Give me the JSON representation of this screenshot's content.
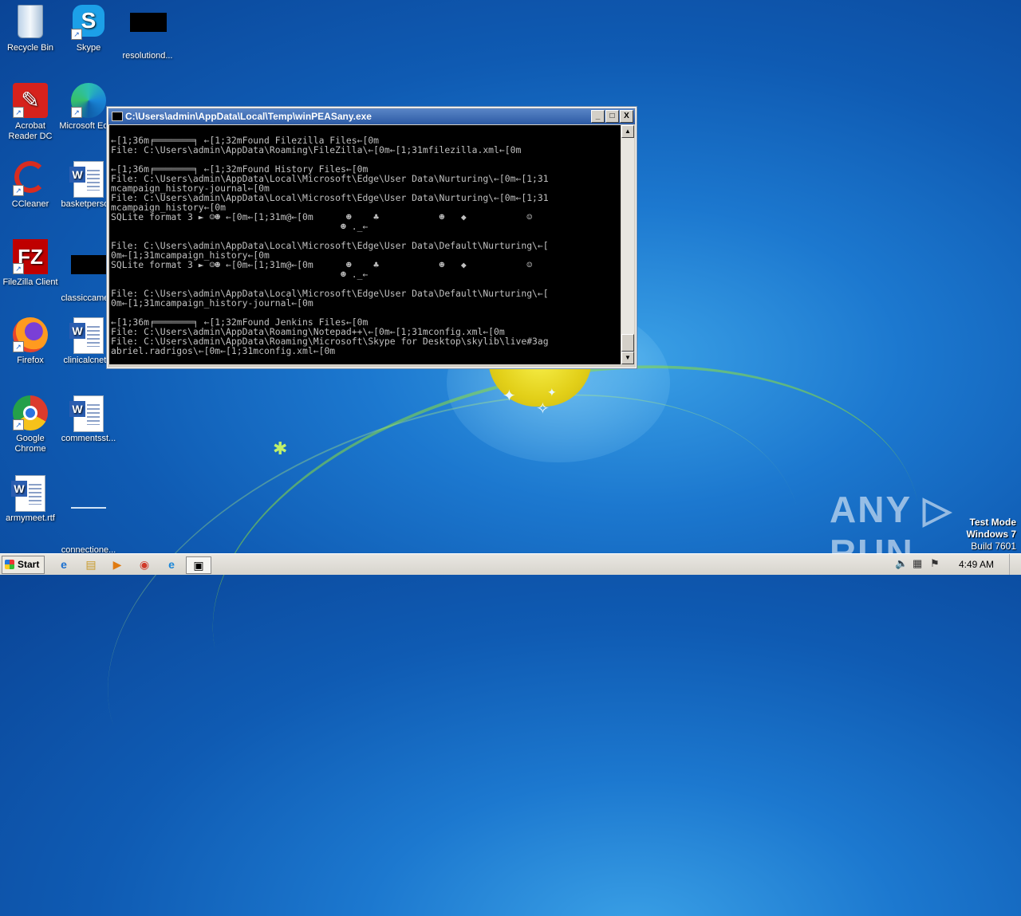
{
  "desktop_icons": [
    {
      "label": "Recycle Bin",
      "icon": "recycle-bin-icon"
    },
    {
      "label": "Skype",
      "icon": "skype-icon"
    },
    {
      "label": "resolutiond...",
      "icon": "redacted-thumbnail-icon"
    },
    {
      "label": "Acrobat Reader DC",
      "icon": "acrobat-icon"
    },
    {
      "label": "Microsoft Edge",
      "icon": "edge-icon"
    },
    {
      "label": "CCleaner",
      "icon": "ccleaner-icon"
    },
    {
      "label": "basketperso...",
      "icon": "word-document-icon"
    },
    {
      "label": "FileZilla Client",
      "icon": "filezilla-icon"
    },
    {
      "label": "classiccame...",
      "icon": "redacted-thumbnail-icon"
    },
    {
      "label": "Firefox",
      "icon": "firefox-icon"
    },
    {
      "label": "clinicalcnet...",
      "icon": "word-document-icon"
    },
    {
      "label": "Google Chrome",
      "icon": "chrome-icon"
    },
    {
      "label": "commentsst...",
      "icon": "word-document-icon"
    },
    {
      "label": "armymeet.rtf",
      "icon": "word-document-icon"
    },
    {
      "label": "connectione...",
      "icon": "blank-file-icon"
    }
  ],
  "console": {
    "title": "C:\\Users\\admin\\AppData\\Local\\Temp\\winPEASany.exe",
    "minimize": "_",
    "maximize": "□",
    "close": "X",
    "output": "←[1;36m╒═══════╕ ←[1;32mFound Filezilla Files←[0m\nFile: C:\\Users\\admin\\AppData\\Roaming\\FileZilla\\←[0m←[1;31mfilezilla.xml←[0m\n\n←[1;36m╒═══════╕ ←[1;32mFound History Files←[0m\nFile: C:\\Users\\admin\\AppData\\Local\\Microsoft\\Edge\\User Data\\Nurturing\\←[0m←[1;31\nmcampaign_history-journal←[0m\nFile: C:\\Users\\admin\\AppData\\Local\\Microsoft\\Edge\\User Data\\Nurturing\\←[0m←[1;31\nmcampaign_history←[0m\nSQLite format 3 ► ☺☻ ←[0m←[1;31m@←[0m      ☻    ♣           ☻   ◆           ☺\n                                          ☻ ._←\n\nFile: C:\\Users\\admin\\AppData\\Local\\Microsoft\\Edge\\User Data\\Default\\Nurturing\\←[\n0m←[1;31mcampaign_history←[0m\nSQLite format 3 ► ☺☻ ←[0m←[1;31m@←[0m      ☻    ♣           ☻   ◆           ☺\n                                          ☻ ._←\n\nFile: C:\\Users\\admin\\AppData\\Local\\Microsoft\\Edge\\User Data\\Default\\Nurturing\\←[\n0m←[1;31mcampaign_history-journal←[0m\n\n←[1;36m╒═══════╕ ←[1;32mFound Jenkins Files←[0m\nFile: C:\\Users\\admin\\AppData\\Roaming\\Notepad++\\←[0m←[1;31mconfig.xml←[0m\nFile: C:\\Users\\admin\\AppData\\Roaming\\Microsoft\\Skype for Desktop\\skylib\\live#3ag\nabriel.radrigos\\←[0m←[1;31mconfig.xml←[0m"
  },
  "watermark": "ANY ▷ RUN",
  "test_mode": {
    "line1": "Test Mode",
    "line2": "Windows 7",
    "line3": "Build 7601"
  },
  "taskbar": {
    "start_label": "Start",
    "apps": [
      {
        "name": "internet-explorer",
        "glyph": "e"
      },
      {
        "name": "explorer",
        "glyph": "▤"
      },
      {
        "name": "media-player",
        "glyph": "▶"
      },
      {
        "name": "chrome",
        "glyph": "◉"
      },
      {
        "name": "edge",
        "glyph": "e"
      },
      {
        "name": "console",
        "glyph": "▣"
      }
    ],
    "clock": "4:49 AM"
  },
  "colors": {
    "accent": "#2c5aa4",
    "desktop": "#1c78cf",
    "console_bg": "#000000",
    "console_fg": "#c0c0c0"
  }
}
